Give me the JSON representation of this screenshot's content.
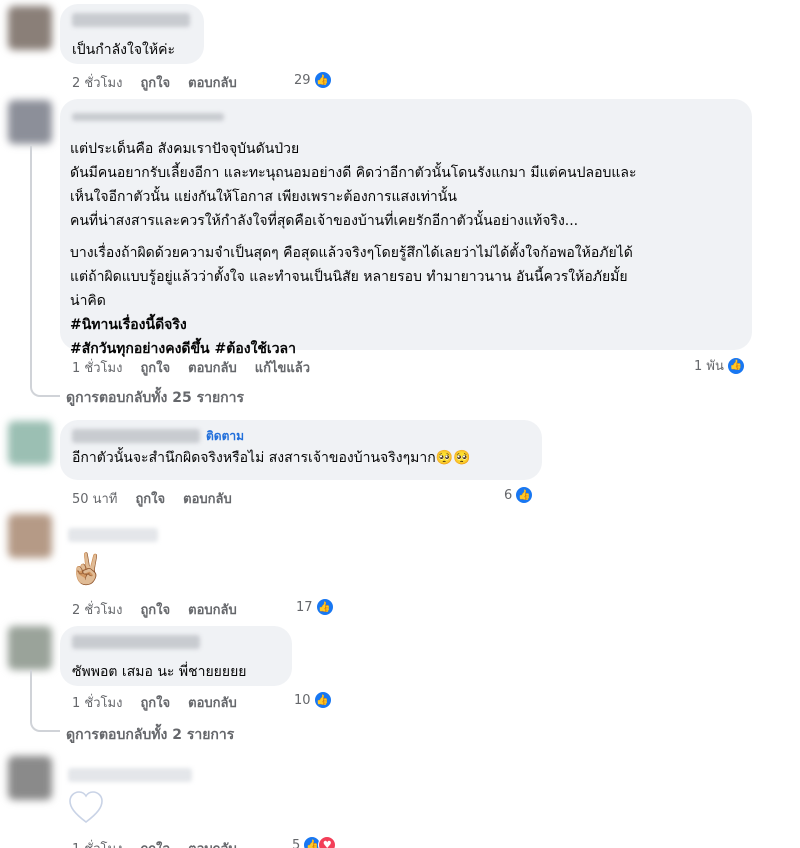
{
  "comments": [
    {
      "text": "เป็นกำลังใจให้ค่ะ",
      "time": "2 ชั่วโมง",
      "like": "ถูกใจ",
      "reply": "ตอบกลับ",
      "reactions": "29",
      "avatar_color": "#8a7f78"
    },
    {
      "paragraph1": [
        "แต่ประเด็นคือ สังคมเราปัจจุบันดันป่วย",
        "ดันมีคนอยากรับเลี้ยงอีกา และทะนุถนอมอย่างดี คิดว่าอีกาตัวนั้นโดนรังแกมา มีแต่คนปลอบและ",
        "เห็นใจอีกาตัวนั้น แย่งกันให้โอกาส เพียงเพราะต้องการแสงเท่านั้น",
        "คนที่น่าสงสารและควรให้กำลังใจที่สุดคือเจ้าของบ้านที่เคยรักอีกาตัวนั้นอย่างแท้จริง..."
      ],
      "paragraph2": [
        "บางเรื่องถ้าผิดด้วยความจำเป็นสุดๆ คือสุดแล้วจริงๆโดยรู้สึกได้เลยว่าไม่ได้ตั้งใจก้อพอให้อภัยได้",
        "แต่ถ้าผิดแบบรู้อยู่แล้วว่าตั้งใจ และทำจนเป็นนิสัย หลายรอบ ทำมายาวนาน อันนี้ควรให้อภัยมั้ย",
        "น่าคิด"
      ],
      "tag1": "#นิทานเรื่องนี้ดีจริง",
      "tag2": "#สักวันทุกอย่างคงดีขึ้น #ต้องใช้เวลา",
      "time": "1 ชั่วโมง",
      "like": "ถูกใจ",
      "reply": "ตอบกลับ",
      "edited": "แก้ไขแล้ว",
      "reactions": "1 พัน",
      "view_replies": "ดูการตอบกลับทั้ง 25 รายการ",
      "avatar_color": "#8c8f99"
    },
    {
      "follow": "ติดตาม",
      "text": "อีกาตัวนั้นจะสำนึกผิดจริงหรือไม่ สงสารเจ้าของบ้านจริงๆมาก",
      "emoji": "🥺🥺",
      "time": "50 นาที",
      "like": "ถูกใจ",
      "reply": "ตอบกลับ",
      "reactions": "6",
      "avatar_color": "#9bbfb3"
    },
    {
      "emoji": "✌🏼",
      "time": "2 ชั่วโมง",
      "like": "ถูกใจ",
      "reply": "ตอบกลับ",
      "reactions": "17",
      "avatar_color": "#b59a86"
    },
    {
      "text": "ซัพพอต เสมอ นะ พี่ชายยยยย",
      "time": "1 ชั่วโมง",
      "like": "ถูกใจ",
      "reply": "ตอบกลับ",
      "reactions": "10",
      "view_replies": "ดูการตอบกลับทั้ง 2 รายการ",
      "avatar_color": "#9aa39a"
    },
    {
      "time": "1 ชั่วโมง",
      "like": "ถูกใจ",
      "reply": "ตอบกลับ",
      "reactions": "5",
      "avatar_color": "#8a8a8a"
    }
  ],
  "icons": {
    "like": "thumbs-up-icon",
    "love": "heart-icon"
  },
  "colors": {
    "like_blue": "#1877f2",
    "love_red": "#f33e58",
    "follow_blue": "#216fdb",
    "bubble_bg": "#f0f2f5",
    "meta_gray": "#65676b"
  }
}
